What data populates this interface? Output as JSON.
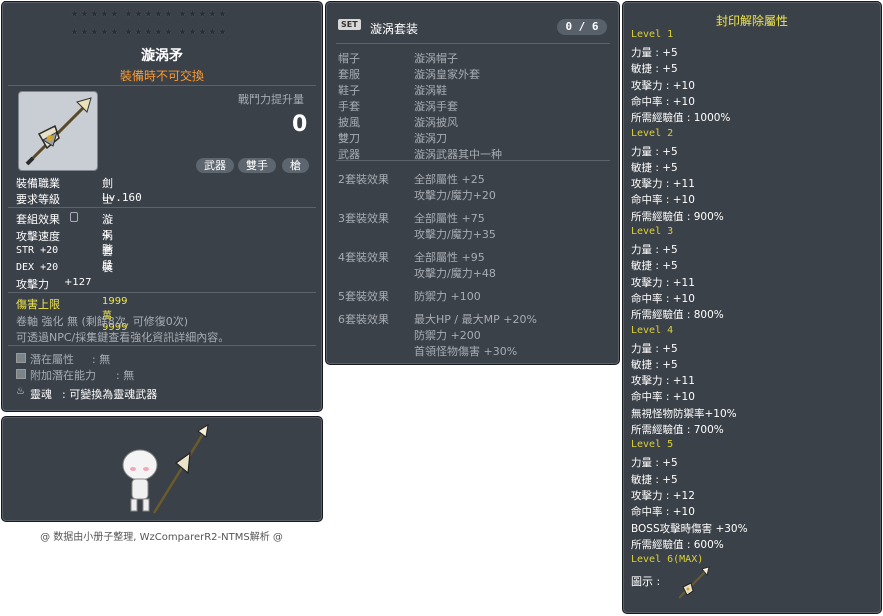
{
  "item_id": "01432187",
  "item": {
    "stars_row1": "★★★★★  ★★★★★  ★★★★★",
    "stars_row2": "★★★★★  ★★★★★  ★★★★★",
    "name": "漩涡矛",
    "trade_note": "裝備時不可交換",
    "power_label": "戰鬥力提升量",
    "power_value": "0",
    "tags": [
      "武器",
      "雙手",
      "槍"
    ],
    "job_label": "裝備職業",
    "job_value": "劍士",
    "level_label": "要求等級",
    "level_value": "Lv.160",
    "set_label": "套組效果",
    "set_value": "漩涡套裝",
    "speed_label": "攻擊速度",
    "speed_value": "4階段",
    "str": "STR  +20",
    "dex": "DEX  +20",
    "atk_label": "攻擊力",
    "atk_value": "+127",
    "damage_cap_label": "傷害上限",
    "damage_cap_value": "1999萬 9999",
    "scroll_line": "卷軸 強化 無 (剩餘8次, 可修復0次)",
    "info_line": "可透過NPC/採集鍵查看強化資訊詳細內容。",
    "potential_label": "潛在屬性",
    "potential_value": ": 無",
    "bonus_potential_label": "附加潛在能力",
    "bonus_potential_value": ": 無",
    "soul_label": "靈魂",
    "soul_value": ": 可變換為靈魂武器"
  },
  "credit": "@ 数据由小册子整理, WzComparerR2-NTMS解析 @",
  "set_panel": {
    "badge": "SET",
    "title": "漩涡套装",
    "count": "0 / 6",
    "pieces": [
      {
        "slot": "帽子",
        "name": "漩涡帽子"
      },
      {
        "slot": "套服",
        "name": "漩涡皇家外套"
      },
      {
        "slot": "鞋子",
        "name": "漩涡鞋"
      },
      {
        "slot": "手套",
        "name": "漩涡手套"
      },
      {
        "slot": "披風",
        "name": "漩涡披风"
      },
      {
        "slot": "雙刀",
        "name": "漩涡刀"
      },
      {
        "slot": "武器",
        "name": "漩涡武器其中一种"
      }
    ],
    "effects": [
      {
        "label": "2套裝效果",
        "lines": [
          "全部屬性 +25",
          "攻擊力/魔力+20"
        ]
      },
      {
        "label": "3套裝效果",
        "lines": [
          "全部屬性 +75",
          "攻擊力/魔力+35"
        ]
      },
      {
        "label": "4套裝效果",
        "lines": [
          "全部屬性 +95",
          "攻擊力/魔力+48"
        ]
      },
      {
        "label": "5套裝效果",
        "lines": [
          "防禦力  +100"
        ]
      },
      {
        "label": "6套裝效果",
        "lines": [
          "最大HP / 最大MP  +20%",
          "防禦力  +200",
          "首領怪物傷害 +30%"
        ]
      }
    ]
  },
  "seal_panel": {
    "title": "封印解除屬性",
    "levels": [
      {
        "label": "Level 1",
        "lines": [
          "力量 : +5",
          "敏捷 : +5",
          "攻擊力 : +10",
          "命中率 : +10",
          "所需經驗值 : 1000%"
        ]
      },
      {
        "label": "Level 2",
        "lines": [
          "力量 : +5",
          "敏捷 : +5",
          "攻擊力 : +11",
          "命中率 : +10",
          "所需經驗值 : 900%"
        ]
      },
      {
        "label": "Level 3",
        "lines": [
          "力量 : +5",
          "敏捷 : +5",
          "攻擊力 : +11",
          "命中率 : +10",
          "所需經驗值 : 800%"
        ]
      },
      {
        "label": "Level 4",
        "lines": [
          "力量 : +5",
          "敏捷 : +5",
          "攻擊力 : +11",
          "命中率 : +10",
          "無視怪物防禦率+10%",
          "所需經驗值 : 700%"
        ]
      },
      {
        "label": "Level 5",
        "lines": [
          "力量 : +5",
          "敏捷 : +5",
          "攻擊力 : +12",
          "命中率 : +10",
          "BOSS攻擊時傷害 +30%",
          "所需經驗值 : 600%"
        ]
      },
      {
        "label": "Level 6(MAX)",
        "lines": []
      }
    ],
    "icon_label": "圖示 :"
  }
}
